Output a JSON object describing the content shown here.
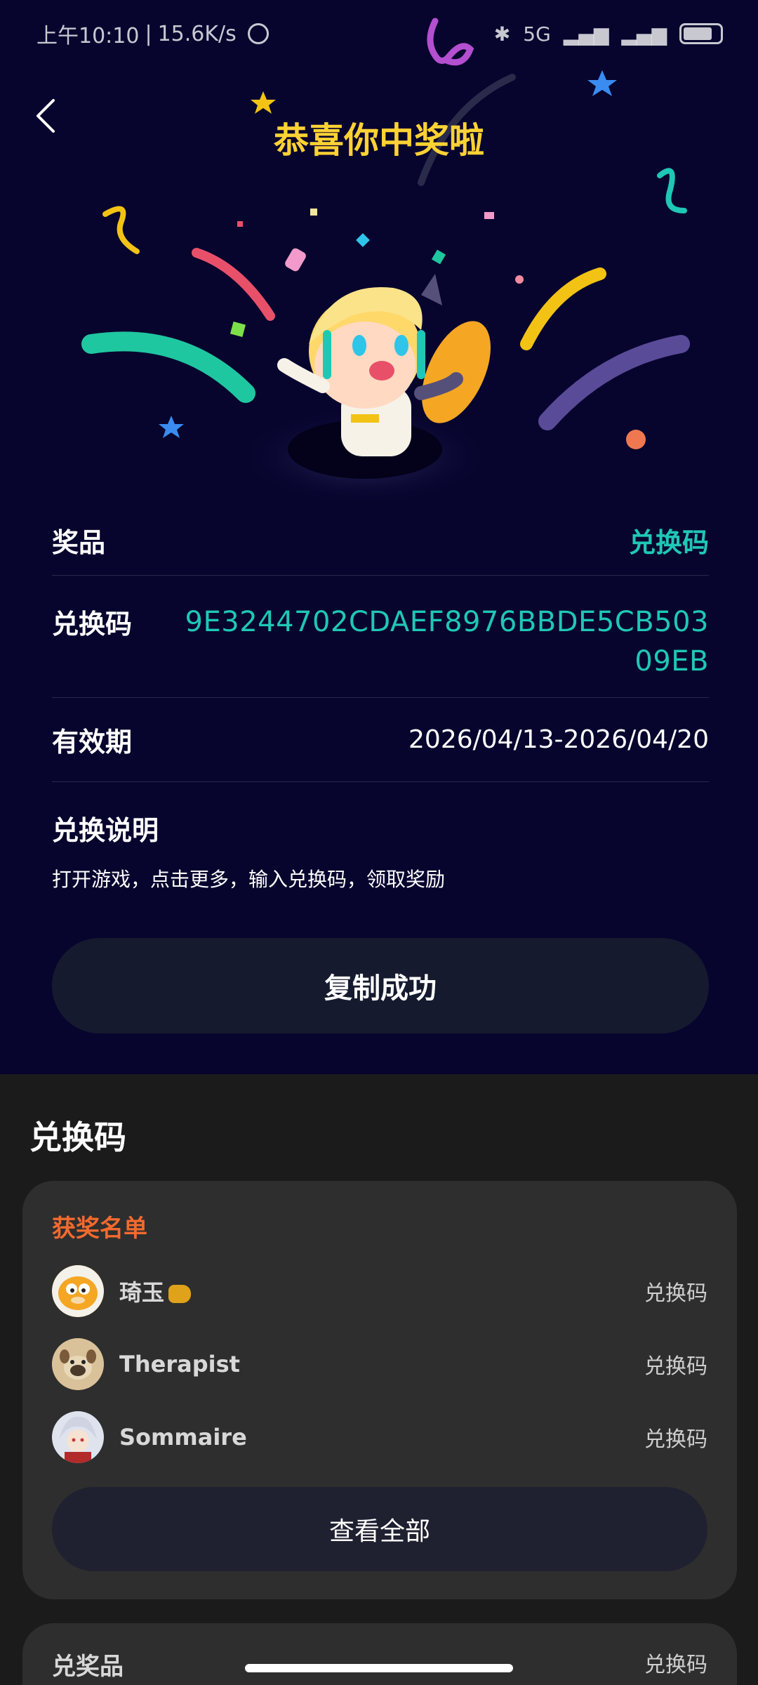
{
  "status_bar": {
    "time": "上午10:10",
    "speed": "15.6K/s",
    "network": "5G"
  },
  "header": {
    "title": "恭喜你中奖啦"
  },
  "prize_details": {
    "prize_label": "奖品",
    "prize_value": "兑换码",
    "code_label": "兑换码",
    "code_value": "9E3244702CDAEF8976BBDE5CB50309EB",
    "validity_label": "有效期",
    "validity_value": "2026/04/13-2026/04/20",
    "instructions_label": "兑换说明",
    "instructions_text": "打开游戏，点击更多，输入兑换码，领取奖励"
  },
  "copy_button_label": "复制成功",
  "section": {
    "title": "兑换码"
  },
  "winners": {
    "title": "获奖名单",
    "list": [
      {
        "name": "琦玉",
        "prize": "兑换码",
        "avatar_color": "#f5a623"
      },
      {
        "name": "Therapist",
        "prize": "兑换码",
        "avatar_color": "#c9a77a"
      },
      {
        "name": "Sommaire",
        "prize": "兑换码",
        "avatar_color": "#8a8fb0"
      }
    ],
    "view_all_label": "查看全部"
  },
  "next_card": {
    "left": "兑奖品",
    "right": "兑换码"
  },
  "colors": {
    "accent_teal": "#1fc7b6",
    "title_yellow": "#ffd233",
    "winners_orange": "#f26a2e",
    "background_top": "#07052e"
  }
}
